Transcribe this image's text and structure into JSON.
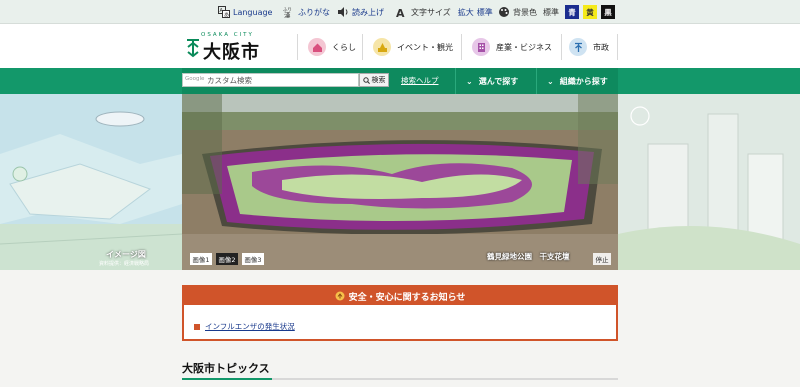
{
  "utility": {
    "language": "Language",
    "furigana": "ふりがな",
    "read_aloud": "読み上げ",
    "text_size_label": "文字サイズ",
    "zoom": "拡大",
    "standard": "標準",
    "bg_color_label": "背景色",
    "bg_standard": "標準",
    "bg_blue": "青",
    "bg_yellow": "黄",
    "bg_black": "黒"
  },
  "logo": {
    "sub": "OSAKA CITY",
    "main": "大阪市"
  },
  "global_nav": [
    {
      "label": "くらし",
      "icon": "house-icon"
    },
    {
      "label": "イベント・観光",
      "icon": "event-icon"
    },
    {
      "label": "産業・ビジネス",
      "icon": "building-icon"
    },
    {
      "label": "市政",
      "icon": "city-mark-icon"
    }
  ],
  "search": {
    "brand": "Google",
    "placeholder": "カスタム検索",
    "button": "検索",
    "help": "検索ヘルプ"
  },
  "menus": {
    "choose": "選んで探す",
    "org": "組織から探す"
  },
  "hero": {
    "left_label": "イメージ図",
    "left_sublabel": "資料提供：経済戦略局",
    "caption": "鶴見緑地公園　干支花壇",
    "stop": "停止",
    "slides": [
      "画像1",
      "画像2",
      "画像3"
    ],
    "active_slide": 1
  },
  "notice": {
    "title": "安全・安心に関するお知らせ",
    "items": [
      "インフルエンザの発生状況"
    ]
  },
  "topics": {
    "title": "大阪市トピックス"
  },
  "colors": {
    "brand_green": "#13986a",
    "notice_orange": "#d0542a",
    "link_blue": "#1a3a8c"
  }
}
